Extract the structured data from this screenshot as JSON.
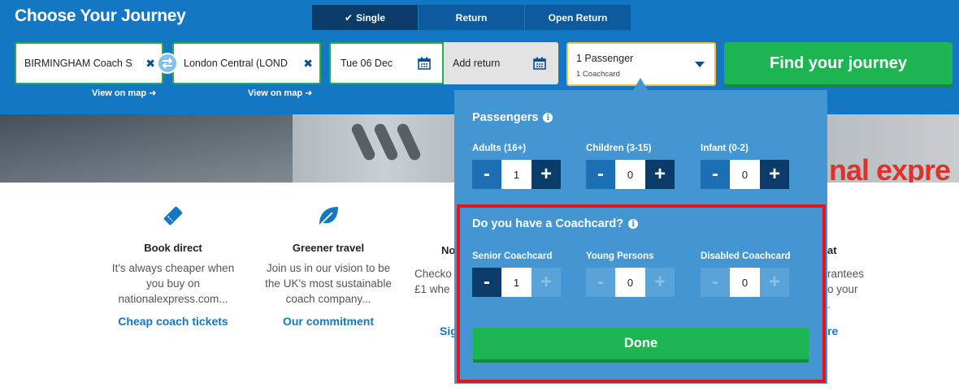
{
  "header": {
    "title": "Choose Your Journey",
    "tabs": [
      "Single",
      "Return",
      "Open Return"
    ],
    "active_tab": "Single",
    "origin": "BIRMINGHAM Coach S",
    "destination": "London Central (LOND",
    "view_on_map": "View on map",
    "date": "Tue 06 Dec",
    "add_return": "Add return",
    "passengers_line1": "1 Passenger",
    "passengers_line2": "1 Coachcard",
    "find_button": "Find your journey"
  },
  "hero": {
    "brand_fragment": "nal expre"
  },
  "features": [
    {
      "icon": "ticket-icon",
      "title": "Book direct",
      "text": [
        "It's always cheaper when",
        "you buy on",
        "nationalexpress.com..."
      ],
      "link": "Cheap coach tickets"
    },
    {
      "icon": "leaf-icon",
      "title": "Greener travel",
      "text": [
        "Join us in our vision to be",
        "the UK's most sustainable",
        "coach company..."
      ],
      "link": "Our commitment"
    }
  ],
  "feature_peeks": {
    "third_title": "No",
    "third_text": [
      "Checko",
      "£1 whe"
    ],
    "third_link": "Sig",
    "fourth_title": "at",
    "fourth_text": [
      "rantees",
      "o your",
      "."
    ],
    "fourth_link": "re"
  },
  "panel": {
    "passengers_title": "Passengers",
    "adults_label": "Adults (16+)",
    "adults_value": "1",
    "children_label": "Children (3-15)",
    "children_value": "0",
    "infant_label": "Infant (0-2)",
    "infant_value": "0",
    "coachcard_title": "Do you have a Coachcard?",
    "senior_label": "Senior Coachcard",
    "senior_value": "1",
    "young_label": "Young Persons",
    "young_value": "0",
    "disabled_label": "Disabled Coachcard",
    "disabled_value": "0",
    "done_button": "Done",
    "minus": "-",
    "plus": "+"
  },
  "colors": {
    "header_bg": "#1477c4",
    "accent_green": "#1cb552",
    "panel_bg": "#4496d3",
    "highlight_red": "#e8141c",
    "pax_border": "#f6c033"
  }
}
